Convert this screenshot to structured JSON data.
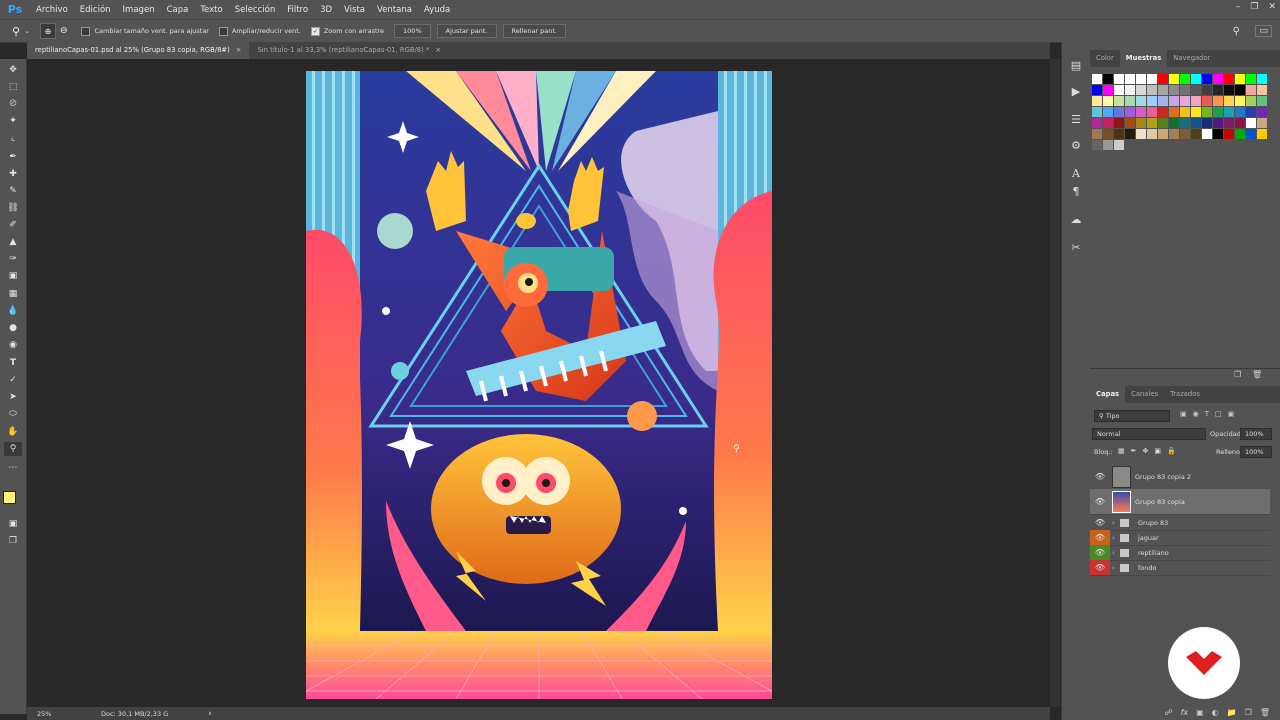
{
  "app": {
    "logo": "Ps"
  },
  "menu": [
    "Archivo",
    "Edición",
    "Imagen",
    "Capa",
    "Texto",
    "Selección",
    "Filtro",
    "3D",
    "Vista",
    "Ventana",
    "Ayuda"
  ],
  "options_bar": {
    "resize_windows": "Cambiar tamaño vent. para ajustar",
    "zoom_all": "Ampliar/reducir vent.",
    "scrubby_zoom": "Zoom con arrastre",
    "zoom_value": "100%",
    "fit_screen": "Ajustar pant.",
    "fill_screen": "Rellenar pant."
  },
  "tabs": [
    {
      "label": "reptilianoCapas-01.psd al 25% (Grupo 83 copia, RGB/8#)",
      "close": "×"
    },
    {
      "label": "Sin título-1 al 33,3% (reptilianoCapas-01, RGB/8) *",
      "close": "×"
    }
  ],
  "status": {
    "zoom": "25%",
    "doc": "Doc: 30,1 MB/2,33 G",
    "arrow": "›"
  },
  "panels_top": {
    "tabs": [
      "Color",
      "Muestras",
      "Navegador"
    ],
    "active": "Muestras"
  },
  "panels_layers": {
    "tabs": [
      "Capas",
      "Canales",
      "Trazados"
    ],
    "filter": "Tipo",
    "blend_mode": "Normal",
    "opacity_label": "Opacidad:",
    "opacity": "100%",
    "lock_label": "Bloq.:",
    "fill_label": "Relleno:",
    "fill": "100%",
    "layers": [
      {
        "name": "Grupo 83 copia 2",
        "type": "layer",
        "eye_color": "",
        "selected": false
      },
      {
        "name": "Grupo 83 copia",
        "type": "layer",
        "eye_color": "",
        "selected": true
      },
      {
        "name": "Grupo 83",
        "type": "group",
        "eye_color": "",
        "selected": false
      },
      {
        "name": "jaguar",
        "type": "group",
        "eye_color": "#c8621a",
        "selected": false
      },
      {
        "name": "reptiliano",
        "type": "group",
        "eye_color": "#4a8a2a",
        "selected": false
      },
      {
        "name": "fondo",
        "type": "group",
        "eye_color": "#c83232",
        "selected": false
      }
    ]
  },
  "swatches": [
    "#ffffff",
    "#000000",
    "#ffffff",
    "#ffffff",
    "#ffffff",
    "#ffffff",
    "#ff0000",
    "#ffff00",
    "#00ff00",
    "#00ffff",
    "#0000ff",
    "#ff00ff",
    "#ff0000",
    "#ffff00",
    "#00ff00",
    "#00ffff",
    "#0000ff",
    "#ff00ff",
    "#ffffff",
    "#f2f2f2",
    "#d9d9d9",
    "#bfbfbf",
    "#a6a6a6",
    "#8c8c8c",
    "#737373",
    "#595959",
    "#404040",
    "#262626",
    "#0d0d0d",
    "#000000",
    "#f4a6a0",
    "#f7c49d",
    "#fde89c",
    "#fff8a5",
    "#c8e3a0",
    "#a7d8b0",
    "#a0dce4",
    "#9ccdf5",
    "#a8b4ed",
    "#c3a6e8",
    "#e6a8d9",
    "#f2a5c2",
    "#ee5a50",
    "#f59751",
    "#fcd651",
    "#fff45c",
    "#a3d35a",
    "#5fc27f",
    "#59c8d8",
    "#4eaaed",
    "#6378e0",
    "#9c5fd9",
    "#d35fc2",
    "#e85e9a",
    "#c8281e",
    "#e06e1e",
    "#f0c01e",
    "#ffe61e",
    "#78b41e",
    "#1e9e4e",
    "#1ea0b4",
    "#1e78c8",
    "#283cb4",
    "#6e28b4",
    "#b42896",
    "#c81e64",
    "#8c1a14",
    "#a04c14",
    "#a88814",
    "#b4a014",
    "#54801a",
    "#146e36",
    "#147080",
    "#14548c",
    "#1c2a80",
    "#4c1c80",
    "#801c6a",
    "#8c1446",
    "#ffffff",
    "#c8a882",
    "#a07850",
    "#784f2a",
    "#503214",
    "#281908",
    "#f0e0c8",
    "#e0c8a0",
    "#c8a878",
    "#a08050",
    "#786030",
    "#504018",
    "#ffffff",
    "#000000",
    "#cc0000",
    "#00aa00",
    "#0055cc",
    "#ffcc00",
    "#666666",
    "#999999",
    "#cccccc"
  ],
  "brand_colors": {
    "badge_mark": "#e02020"
  }
}
